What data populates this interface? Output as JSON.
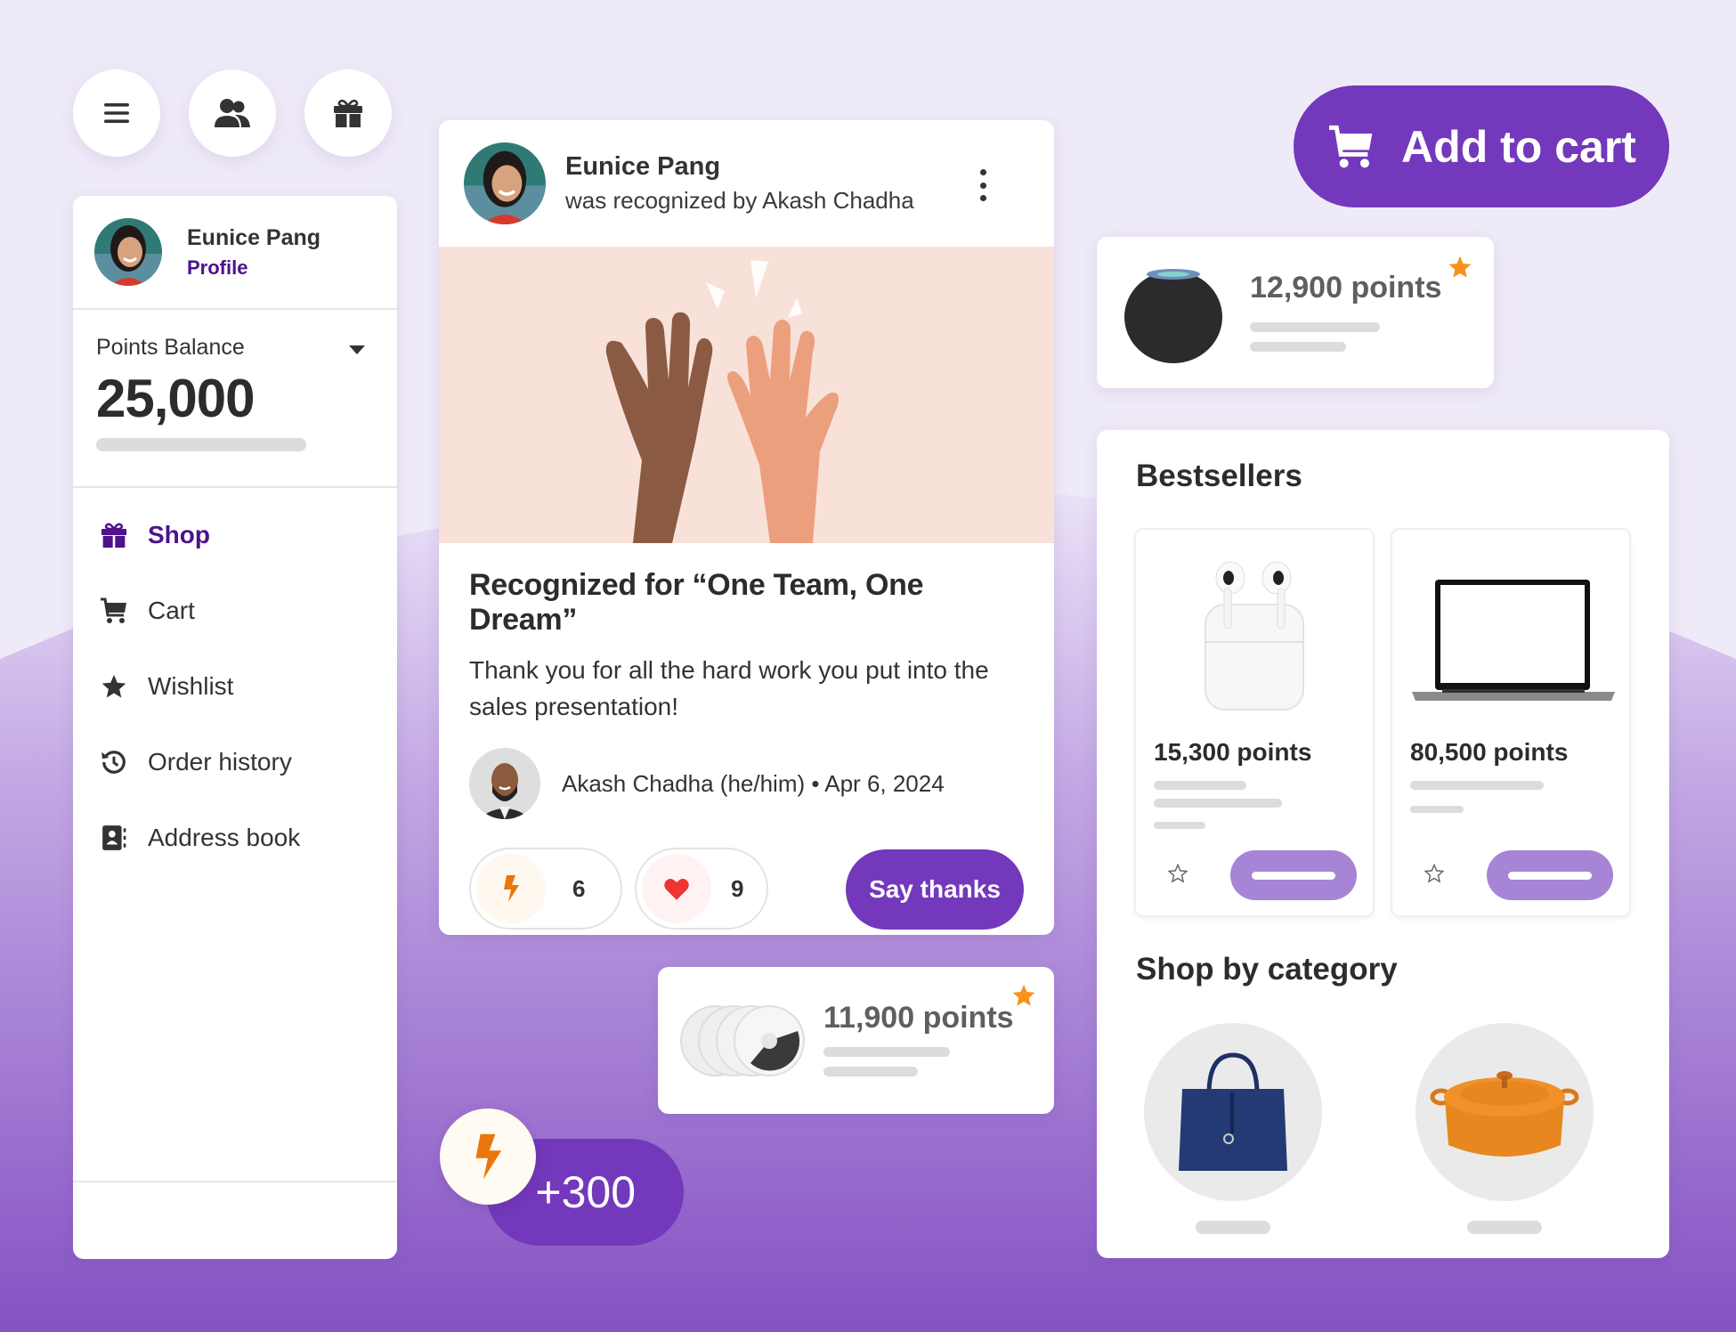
{
  "colors": {
    "brand_purple": "#7338bb",
    "profile_link_purple": "#4d128c",
    "light_purple_button": "#a685d6",
    "star_orange": "#f7921e",
    "bolt_orange": "#e8760a",
    "heart_red": "#f03333",
    "skeleton_gray": "#dcdcdc",
    "page_bg_top": "#efeaf8",
    "page_bg_bottom": "#8a56c6"
  },
  "top_buttons": [
    {
      "name": "menu",
      "icon": "hamburger-icon"
    },
    {
      "name": "people",
      "icon": "users-icon"
    },
    {
      "name": "rewards",
      "icon": "gift-icon"
    }
  ],
  "sidebar": {
    "user_name": "Eunice Pang",
    "profile_link": "Profile",
    "points_label": "Points Balance",
    "points_value": "25,000",
    "nav": [
      {
        "label": "Shop",
        "icon": "gift-icon",
        "active": true
      },
      {
        "label": "Cart",
        "icon": "cart-icon",
        "active": false
      },
      {
        "label": "Wishlist",
        "icon": "star-icon",
        "active": false
      },
      {
        "label": "Order history",
        "icon": "history-icon",
        "active": false
      },
      {
        "label": "Address book",
        "icon": "address-book-icon",
        "active": false
      }
    ]
  },
  "feed": {
    "recipient": "Eunice Pang",
    "subtitle": "was recognized by Akash Chadha",
    "title": "Recognized for “One Team, One Dream”",
    "message": "Thank you for all the hard work you put into the sales presentation!",
    "giver_line": "Akash Chadha (he/him) • Apr 6, 2024",
    "reactions": [
      {
        "icon": "bolt-icon",
        "count": "6"
      },
      {
        "icon": "heart-icon",
        "count": "9"
      }
    ],
    "say_thanks_label": "Say thanks"
  },
  "add_to_cart_label": "Add to cart",
  "featured_items": [
    {
      "name": "smart-speaker",
      "points": "12,900 points",
      "favorited": true
    },
    {
      "name": "trackers",
      "points": "11,900 points",
      "favorited": true
    }
  ],
  "shop": {
    "bestsellers_title": "Bestsellers",
    "bestsellers": [
      {
        "name": "earbuds",
        "points": "15,300 points"
      },
      {
        "name": "laptop",
        "points": "80,500 points"
      }
    ],
    "category_title": "Shop by category",
    "categories": [
      {
        "name": "bags"
      },
      {
        "name": "cookware"
      }
    ]
  },
  "points_award": "+300"
}
